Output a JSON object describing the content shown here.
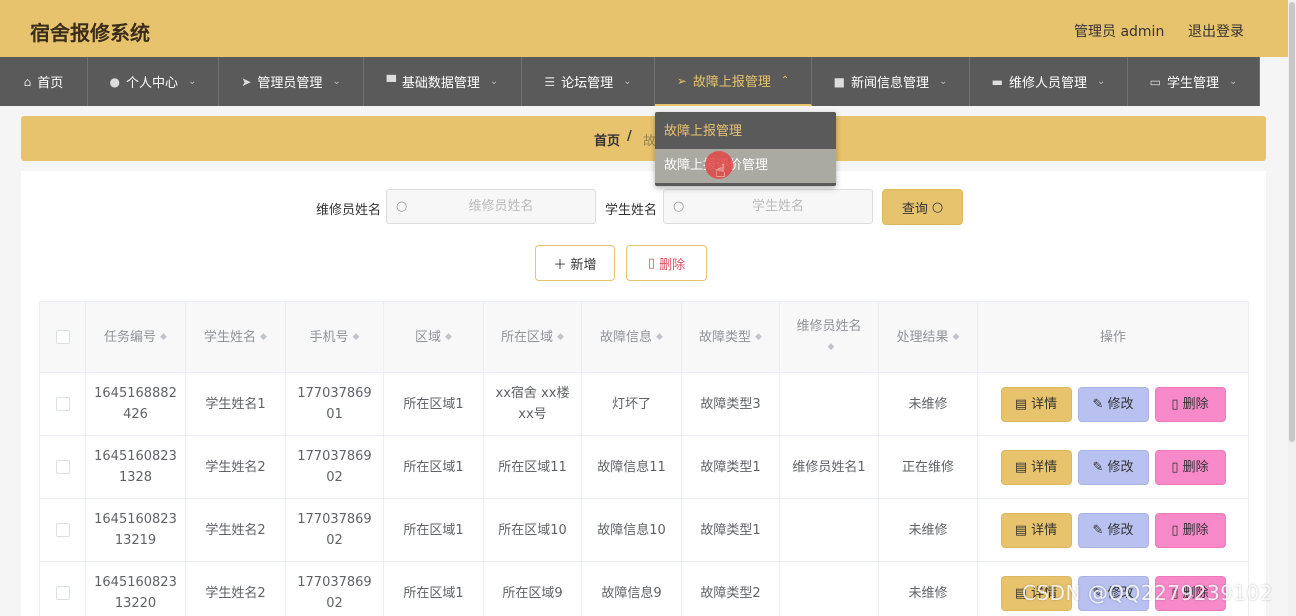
{
  "header": {
    "title": "宿舍报修系统",
    "admin_label": "管理员 admin",
    "logout_label": "退出登录",
    "background_color": "#e8c36e"
  },
  "nav": {
    "items": [
      {
        "label": "首页",
        "icon": "home-icon",
        "has_caret": false
      },
      {
        "label": "个人中心",
        "icon": "user-icon",
        "has_caret": true
      },
      {
        "label": "管理员管理",
        "icon": "send-icon",
        "has_caret": true
      },
      {
        "label": "基础数据管理",
        "icon": "monitor-icon",
        "has_caret": true
      },
      {
        "label": "论坛管理",
        "icon": "sliders-icon",
        "has_caret": true
      },
      {
        "label": "故障上报管理",
        "icon": "location-icon",
        "has_caret": true,
        "active": true
      },
      {
        "label": "新闻信息管理",
        "icon": "truck-icon",
        "has_caret": true
      },
      {
        "label": "维修人员管理",
        "icon": "printer-icon",
        "has_caret": true
      },
      {
        "label": "学生管理",
        "icon": "chat-icon",
        "has_caret": true
      }
    ],
    "active_color": "#e8c36e"
  },
  "dropdown": {
    "items": [
      "故障上报管理",
      "故障上报评价管理"
    ]
  },
  "breadcrumb": {
    "home": "首页",
    "separator": "/",
    "current": "故障上报管理"
  },
  "search": {
    "repairer_label": "维修员姓名",
    "repairer_placeholder": "维修员姓名",
    "student_label": "学生姓名",
    "student_placeholder": "学生姓名",
    "query_label": "查询"
  },
  "actions": {
    "add_label": "新增",
    "delete_label": "删除"
  },
  "table": {
    "columns": [
      "任务编号",
      "学生姓名",
      "手机号",
      "区域",
      "所在区域",
      "故障信息",
      "故障类型",
      "维修员姓名",
      "处理结果",
      "操作"
    ],
    "row_actions": {
      "detail": "详情",
      "edit": "修改",
      "delete": "删除"
    },
    "rows": [
      {
        "id": "1645168882426",
        "student": "学生姓名1",
        "phone": "17703786901",
        "area": "所在区域1",
        "location": "xx宿舍 xx楼 xx号",
        "fault": "灯坏了",
        "type": "故障类型3",
        "repairer": "",
        "result": "未维修"
      },
      {
        "id": "16451608231328",
        "student": "学生姓名2",
        "phone": "17703786902",
        "area": "所在区域1",
        "location": "所在区域11",
        "fault": "故障信息11",
        "type": "故障类型1",
        "repairer": "维修员姓名1",
        "result": "正在维修"
      },
      {
        "id": "164516082313219",
        "student": "学生姓名2",
        "phone": "17703786902",
        "area": "所在区域1",
        "location": "所在区域10",
        "fault": "故障信息10",
        "type": "故障类型1",
        "repairer": "",
        "result": "未维修"
      },
      {
        "id": "164516082313220",
        "student": "学生姓名2",
        "phone": "17703786902",
        "area": "所在区域1",
        "location": "所在区域9",
        "fault": "故障信息9",
        "type": "故障类型2",
        "repairer": "",
        "result": "未维修"
      }
    ]
  },
  "watermark": "CSDN @QQ2279239102"
}
